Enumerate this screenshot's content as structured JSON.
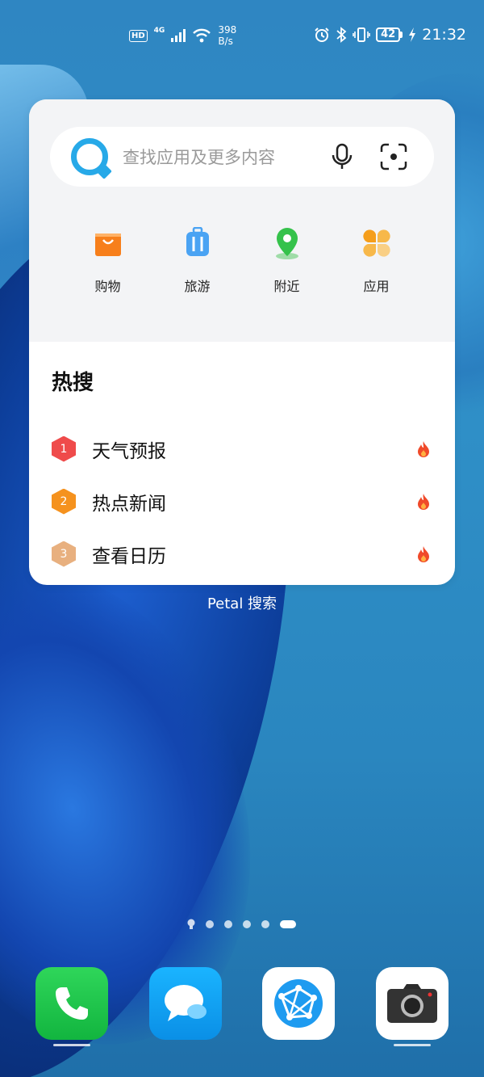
{
  "status_bar": {
    "hd": "HD",
    "network": "4G",
    "speed_value": "398",
    "speed_unit": "B/s",
    "battery": "42",
    "time": "21:32"
  },
  "widget": {
    "search_placeholder": "查找应用及更多内容",
    "shortcuts": [
      {
        "label": "购物",
        "icon": "shopping-bag-icon",
        "color": "#f77f1b"
      },
      {
        "label": "旅游",
        "icon": "suitcase-icon",
        "color": "#4aa3f3"
      },
      {
        "label": "附近",
        "icon": "location-pin-icon",
        "color": "#35c24b"
      },
      {
        "label": "应用",
        "icon": "apps-grid-icon",
        "color": "#f5a623"
      }
    ],
    "hot_title": "热搜",
    "hot_items": [
      {
        "rank": "1",
        "text": "天气预报",
        "color": "#ef4b4b"
      },
      {
        "rank": "2",
        "text": "热点新闻",
        "color": "#f5921e"
      },
      {
        "rank": "3",
        "text": "查看日历",
        "color": "#e8b07f"
      }
    ],
    "label": "Petal 搜索"
  },
  "dock": {
    "apps": [
      {
        "name": "phone",
        "icon": "phone-icon"
      },
      {
        "name": "messages",
        "icon": "message-bubble-icon"
      },
      {
        "name": "browser",
        "icon": "browser-globe-icon"
      },
      {
        "name": "camera",
        "icon": "camera-icon"
      }
    ]
  },
  "pages": {
    "count": 5,
    "active": 5
  }
}
